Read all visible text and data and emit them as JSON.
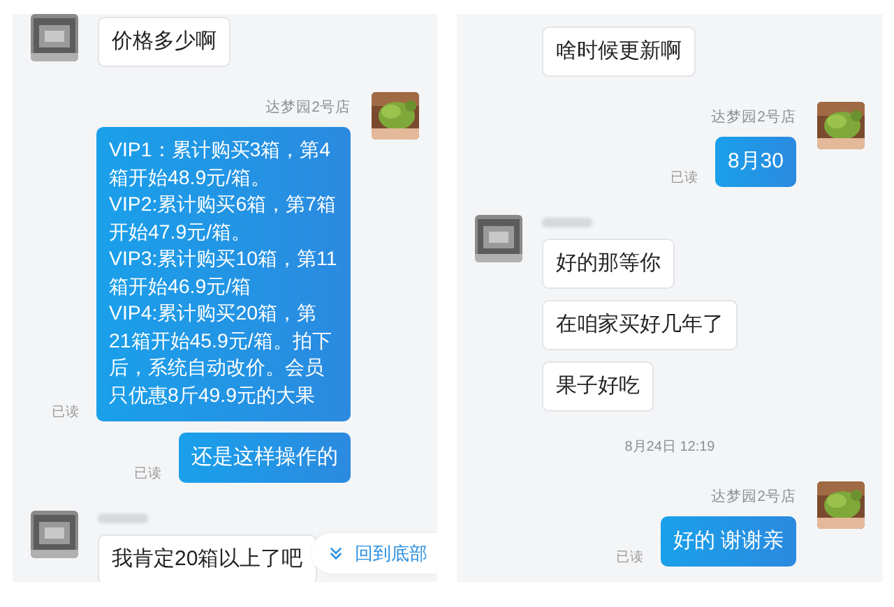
{
  "panels": [
    {
      "messages": [
        {
          "kind": "incoming",
          "avatar": true,
          "hidden_name": false,
          "text": "价格多少啊"
        },
        {
          "kind": "outgoing",
          "sender": "达梦园2号店",
          "text": "VIP1：累计购买3箱，第4箱开始48.9元/箱。\nVIP2:累计购买6箱，第7箱开始47.9元/箱。\nVIP3:累计购买10箱，第11箱开始46.9元/箱\nVIP4:累计购买20箱，第21箱开始45.9元/箱。拍下后，系统自动改价。会员只优惠8斤49.9元的大果",
          "read": "已读"
        },
        {
          "kind": "outgoing",
          "text": "还是这样操作的",
          "read": "已读"
        },
        {
          "kind": "incoming",
          "avatar": true,
          "hidden_name": true,
          "text": "我肯定20箱以上了吧"
        }
      ],
      "scroll_button": {
        "label": "回到底部"
      }
    },
    {
      "messages": [
        {
          "kind": "incoming",
          "avatar": false,
          "hidden_name": false,
          "text": "啥时候更新啊"
        },
        {
          "kind": "outgoing",
          "sender": "达梦园2号店",
          "text": "8月30",
          "read": "已读"
        },
        {
          "kind": "incoming",
          "avatar": true,
          "hidden_name": true,
          "text": "好的那等你"
        },
        {
          "kind": "incoming",
          "avatar": false,
          "hidden_name": false,
          "text": "在咱家买好几年了"
        },
        {
          "kind": "incoming",
          "avatar": false,
          "hidden_name": false,
          "text": "果子好吃"
        },
        {
          "kind": "time",
          "text": "8月24日 12:19"
        },
        {
          "kind": "outgoing",
          "sender": "达梦园2号店",
          "text": "好的 谢谢亲",
          "read": "已读"
        }
      ]
    }
  ]
}
